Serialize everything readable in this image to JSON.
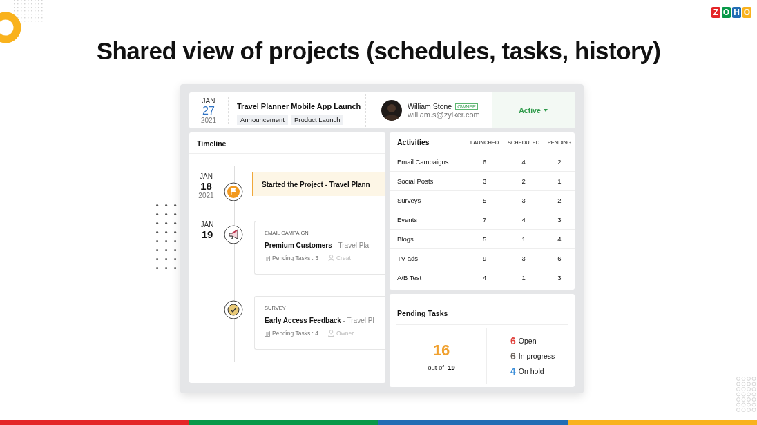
{
  "slide_title": "Shared view of projects (schedules, tasks, history)",
  "logo": [
    "Z",
    "O",
    "H",
    "O"
  ],
  "header": {
    "month": "JAN",
    "day": "27",
    "year": "2021",
    "project": "Travel Planner Mobile App Launch",
    "tags": [
      "Announcement",
      "Product Launch"
    ],
    "owner_name": "William Stone",
    "owner_badge": "OWNER",
    "owner_email": "william.s@zylker.com",
    "status": "Active"
  },
  "timeline": {
    "title": "Timeline",
    "items": [
      {
        "kind": "milestone",
        "month": "JAN",
        "day": "18",
        "year": "2021",
        "title": "Started the Project - Travel Plann"
      },
      {
        "kind": "campaign",
        "month": "JAN",
        "day": "19",
        "category": "EMAIL CAMPAIGN",
        "title": "**Premium Customers** - Travel Pla",
        "tasks": "Pending Tasks : 3",
        "person": "Creat"
      },
      {
        "kind": "campaign",
        "category": "SURVEY",
        "title": "**Early Access Feedback** - Travel Pl",
        "tasks": "Pending Tasks : 4",
        "person": "Owner"
      }
    ]
  },
  "activities": {
    "columns": [
      "Activities",
      "LAUNCHED",
      "SCHEDULED",
      "PENDING"
    ],
    "rows": [
      [
        "Email Campaigns",
        "6",
        "4",
        "2"
      ],
      [
        "Social Posts",
        "3",
        "2",
        "1"
      ],
      [
        "Surveys",
        "5",
        "3",
        "2"
      ],
      [
        "Events",
        "7",
        "4",
        "3"
      ],
      [
        "Blogs",
        "5",
        "1",
        "4"
      ],
      [
        "TV ads",
        "9",
        "3",
        "6"
      ],
      [
        "A/B Test",
        "4",
        "1",
        "3"
      ]
    ]
  },
  "pending_tasks": {
    "title": "Pending Tasks",
    "total": "16",
    "out_of_label": "out of",
    "out_of": "19",
    "breakdown": [
      {
        "count": "6",
        "label": "Open",
        "color": "#e0413c"
      },
      {
        "count": "6",
        "label": "In progress",
        "color": "#6b625c"
      },
      {
        "count": "4",
        "label": "On hold",
        "color": "#3d8fd9"
      }
    ]
  }
}
